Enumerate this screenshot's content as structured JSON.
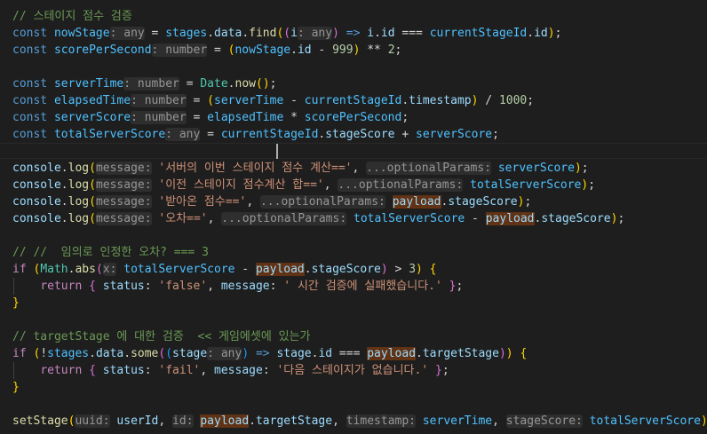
{
  "editor": {
    "language": "typescript",
    "theme": "dark",
    "cursor": {
      "line": 8,
      "column": 38
    },
    "highlighted_identifier": "payload",
    "lines": [
      [
        {
          "t": "// 스테이지 점수 검증",
          "c": "comment"
        }
      ],
      [
        {
          "t": "const ",
          "c": "keyword"
        },
        {
          "t": "nowStage",
          "c": "const"
        },
        {
          "t": ": any",
          "c": "hint"
        },
        {
          "t": " = ",
          "c": "text"
        },
        {
          "t": "stages",
          "c": "const"
        },
        {
          "t": ".",
          "c": "text"
        },
        {
          "t": "data",
          "c": "var"
        },
        {
          "t": ".",
          "c": "text"
        },
        {
          "t": "find",
          "c": "func"
        },
        {
          "t": "(",
          "c": "paren1"
        },
        {
          "t": "(",
          "c": "paren2"
        },
        {
          "t": "i",
          "c": "var"
        },
        {
          "t": ": any",
          "c": "hint"
        },
        {
          "t": ")",
          "c": "paren2"
        },
        {
          "t": " => ",
          "c": "keyword"
        },
        {
          "t": "i",
          "c": "var"
        },
        {
          "t": ".",
          "c": "text"
        },
        {
          "t": "id",
          "c": "var"
        },
        {
          "t": " === ",
          "c": "text"
        },
        {
          "t": "currentStageId",
          "c": "const"
        },
        {
          "t": ".",
          "c": "text"
        },
        {
          "t": "id",
          "c": "var"
        },
        {
          "t": ")",
          "c": "paren1"
        },
        {
          "t": ";",
          "c": "text"
        }
      ],
      [
        {
          "t": "const ",
          "c": "keyword"
        },
        {
          "t": "scorePerSecond",
          "c": "const"
        },
        {
          "t": ": number",
          "c": "hint"
        },
        {
          "t": " = ",
          "c": "text"
        },
        {
          "t": "(",
          "c": "paren1"
        },
        {
          "t": "nowStage",
          "c": "const"
        },
        {
          "t": ".",
          "c": "text"
        },
        {
          "t": "id",
          "c": "var"
        },
        {
          "t": " - ",
          "c": "text"
        },
        {
          "t": "999",
          "c": "number"
        },
        {
          "t": ")",
          "c": "paren1"
        },
        {
          "t": " ** ",
          "c": "text"
        },
        {
          "t": "2",
          "c": "number"
        },
        {
          "t": ";",
          "c": "text"
        }
      ],
      [],
      [
        {
          "t": "const ",
          "c": "keyword"
        },
        {
          "t": "serverTime",
          "c": "const"
        },
        {
          "t": ": number",
          "c": "hint"
        },
        {
          "t": " = ",
          "c": "text"
        },
        {
          "t": "Date",
          "c": "type"
        },
        {
          "t": ".",
          "c": "text"
        },
        {
          "t": "now",
          "c": "func"
        },
        {
          "t": "(",
          "c": "paren1"
        },
        {
          "t": ")",
          "c": "paren1"
        },
        {
          "t": ";",
          "c": "text"
        }
      ],
      [
        {
          "t": "const ",
          "c": "keyword"
        },
        {
          "t": "elapsedTime",
          "c": "const"
        },
        {
          "t": ": number",
          "c": "hint"
        },
        {
          "t": " = ",
          "c": "text"
        },
        {
          "t": "(",
          "c": "paren1"
        },
        {
          "t": "serverTime",
          "c": "const"
        },
        {
          "t": " - ",
          "c": "text"
        },
        {
          "t": "currentStageId",
          "c": "const"
        },
        {
          "t": ".",
          "c": "text"
        },
        {
          "t": "timestamp",
          "c": "var"
        },
        {
          "t": ")",
          "c": "paren1"
        },
        {
          "t": " / ",
          "c": "text"
        },
        {
          "t": "1000",
          "c": "number"
        },
        {
          "t": ";",
          "c": "text"
        }
      ],
      [
        {
          "t": "const ",
          "c": "keyword"
        },
        {
          "t": "serverScore",
          "c": "const"
        },
        {
          "t": ": number",
          "c": "hint"
        },
        {
          "t": " = ",
          "c": "text"
        },
        {
          "t": "elapsedTime",
          "c": "const"
        },
        {
          "t": " * ",
          "c": "text"
        },
        {
          "t": "scorePerSecond",
          "c": "const"
        },
        {
          "t": ";",
          "c": "text"
        }
      ],
      [
        {
          "t": "const ",
          "c": "keyword"
        },
        {
          "t": "totalServerScore",
          "c": "const"
        },
        {
          "t": ": any",
          "c": "hint"
        },
        {
          "t": " = ",
          "c": "text"
        },
        {
          "t": "currentStageId",
          "c": "const"
        },
        {
          "t": ".",
          "c": "text"
        },
        {
          "t": "stageScore",
          "c": "var"
        },
        {
          "t": " + ",
          "c": "text"
        },
        {
          "t": "serverScore",
          "c": "const"
        },
        {
          "t": ";",
          "c": "text"
        }
      ],
      [],
      [
        {
          "t": "console",
          "c": "var"
        },
        {
          "t": ".",
          "c": "text"
        },
        {
          "t": "log",
          "c": "func"
        },
        {
          "t": "(",
          "c": "paren1"
        },
        {
          "t": "message:",
          "c": "hint"
        },
        {
          "t": " ",
          "c": "text"
        },
        {
          "t": "'서버의 이번 스테이지 점수 계산=='",
          "c": "string"
        },
        {
          "t": ", ",
          "c": "text"
        },
        {
          "t": "...optionalParams:",
          "c": "hint"
        },
        {
          "t": " ",
          "c": "text"
        },
        {
          "t": "serverScore",
          "c": "const"
        },
        {
          "t": ")",
          "c": "paren1"
        },
        {
          "t": ";",
          "c": "text"
        }
      ],
      [
        {
          "t": "console",
          "c": "var"
        },
        {
          "t": ".",
          "c": "text"
        },
        {
          "t": "log",
          "c": "func"
        },
        {
          "t": "(",
          "c": "paren1"
        },
        {
          "t": "message:",
          "c": "hint"
        },
        {
          "t": " ",
          "c": "text"
        },
        {
          "t": "'이전 스테이지 점수계산 합=='",
          "c": "string"
        },
        {
          "t": ", ",
          "c": "text"
        },
        {
          "t": "...optionalParams:",
          "c": "hint"
        },
        {
          "t": " ",
          "c": "text"
        },
        {
          "t": "totalServerScore",
          "c": "const"
        },
        {
          "t": ")",
          "c": "paren1"
        },
        {
          "t": ";",
          "c": "text"
        }
      ],
      [
        {
          "t": "console",
          "c": "var"
        },
        {
          "t": ".",
          "c": "text"
        },
        {
          "t": "log",
          "c": "func"
        },
        {
          "t": "(",
          "c": "paren1"
        },
        {
          "t": "message:",
          "c": "hint"
        },
        {
          "t": " ",
          "c": "text"
        },
        {
          "t": "'받아온 점수=='",
          "c": "string"
        },
        {
          "t": ", ",
          "c": "text"
        },
        {
          "t": "...optionalParams:",
          "c": "hint"
        },
        {
          "t": " ",
          "c": "text"
        },
        {
          "t": "payload",
          "c": "var",
          "hl": true
        },
        {
          "t": ".",
          "c": "text"
        },
        {
          "t": "stageScore",
          "c": "var"
        },
        {
          "t": ")",
          "c": "paren1"
        },
        {
          "t": ";",
          "c": "text"
        }
      ],
      [
        {
          "t": "console",
          "c": "var"
        },
        {
          "t": ".",
          "c": "text"
        },
        {
          "t": "log",
          "c": "func"
        },
        {
          "t": "(",
          "c": "paren1"
        },
        {
          "t": "message:",
          "c": "hint"
        },
        {
          "t": " ",
          "c": "text"
        },
        {
          "t": "'오차=='",
          "c": "string"
        },
        {
          "t": ", ",
          "c": "text"
        },
        {
          "t": "...optionalParams:",
          "c": "hint"
        },
        {
          "t": " ",
          "c": "text"
        },
        {
          "t": "totalServerScore",
          "c": "const"
        },
        {
          "t": " - ",
          "c": "text"
        },
        {
          "t": "payload",
          "c": "var",
          "hl": true
        },
        {
          "t": ".",
          "c": "text"
        },
        {
          "t": "stageScore",
          "c": "var"
        },
        {
          "t": ")",
          "c": "paren1"
        },
        {
          "t": ";",
          "c": "text"
        }
      ],
      [],
      [
        {
          "t": "// //  임의로 인정한 오차? === 3",
          "c": "comment"
        }
      ],
      [
        {
          "t": "if ",
          "c": "control"
        },
        {
          "t": "(",
          "c": "paren1"
        },
        {
          "t": "Math",
          "c": "type"
        },
        {
          "t": ".",
          "c": "text"
        },
        {
          "t": "abs",
          "c": "func"
        },
        {
          "t": "(",
          "c": "paren2"
        },
        {
          "t": "x:",
          "c": "hint"
        },
        {
          "t": " ",
          "c": "text"
        },
        {
          "t": "totalServerScore",
          "c": "const"
        },
        {
          "t": " - ",
          "c": "text"
        },
        {
          "t": "payload",
          "c": "var",
          "hl": true
        },
        {
          "t": ".",
          "c": "text"
        },
        {
          "t": "stageScore",
          "c": "var"
        },
        {
          "t": ")",
          "c": "paren2"
        },
        {
          "t": " > ",
          "c": "text"
        },
        {
          "t": "3",
          "c": "number"
        },
        {
          "t": ")",
          "c": "paren1"
        },
        {
          "t": " ",
          "c": "text"
        },
        {
          "t": "{",
          "c": "paren1"
        }
      ],
      [
        {
          "t": "    ",
          "c": "text"
        },
        {
          "t": "return ",
          "c": "control"
        },
        {
          "t": "{",
          "c": "paren2"
        },
        {
          "t": " ",
          "c": "text"
        },
        {
          "t": "status",
          "c": "var"
        },
        {
          "t": ": ",
          "c": "text"
        },
        {
          "t": "'false'",
          "c": "string"
        },
        {
          "t": ", ",
          "c": "text"
        },
        {
          "t": "message",
          "c": "var"
        },
        {
          "t": ": ",
          "c": "text"
        },
        {
          "t": "' 시간 검증에 실패했습니다.'",
          "c": "string"
        },
        {
          "t": " ",
          "c": "text"
        },
        {
          "t": "}",
          "c": "paren2"
        },
        {
          "t": ";",
          "c": "text"
        }
      ],
      [
        {
          "t": "}",
          "c": "paren1"
        }
      ],
      [],
      [
        {
          "t": "// targetStage 에 대한 검증  << 게임에셋에 있는가",
          "c": "comment"
        }
      ],
      [
        {
          "t": "if ",
          "c": "control"
        },
        {
          "t": "(",
          "c": "paren1"
        },
        {
          "t": "!",
          "c": "text"
        },
        {
          "t": "stages",
          "c": "const"
        },
        {
          "t": ".",
          "c": "text"
        },
        {
          "t": "data",
          "c": "var"
        },
        {
          "t": ".",
          "c": "text"
        },
        {
          "t": "some",
          "c": "func"
        },
        {
          "t": "(",
          "c": "paren2"
        },
        {
          "t": "(",
          "c": "paren3"
        },
        {
          "t": "stage",
          "c": "var"
        },
        {
          "t": ": any",
          "c": "hint"
        },
        {
          "t": ")",
          "c": "paren3"
        },
        {
          "t": " => ",
          "c": "keyword"
        },
        {
          "t": "stage",
          "c": "var"
        },
        {
          "t": ".",
          "c": "text"
        },
        {
          "t": "id",
          "c": "var"
        },
        {
          "t": " === ",
          "c": "text"
        },
        {
          "t": "payload",
          "c": "var",
          "hl": true
        },
        {
          "t": ".",
          "c": "text"
        },
        {
          "t": "targetStage",
          "c": "var"
        },
        {
          "t": ")",
          "c": "paren2"
        },
        {
          "t": ")",
          "c": "paren1"
        },
        {
          "t": " ",
          "c": "text"
        },
        {
          "t": "{",
          "c": "paren1"
        }
      ],
      [
        {
          "t": "    ",
          "c": "text"
        },
        {
          "t": "return ",
          "c": "control"
        },
        {
          "t": "{",
          "c": "paren2"
        },
        {
          "t": " ",
          "c": "text"
        },
        {
          "t": "status",
          "c": "var"
        },
        {
          "t": ": ",
          "c": "text"
        },
        {
          "t": "'fail'",
          "c": "string"
        },
        {
          "t": ", ",
          "c": "text"
        },
        {
          "t": "message",
          "c": "var"
        },
        {
          "t": ": ",
          "c": "text"
        },
        {
          "t": "'다음 스테이지가 없습니다.'",
          "c": "string"
        },
        {
          "t": " ",
          "c": "text"
        },
        {
          "t": "}",
          "c": "paren2"
        },
        {
          "t": ";",
          "c": "text"
        }
      ],
      [
        {
          "t": "}",
          "c": "paren1"
        }
      ],
      [],
      [
        {
          "t": "setStage",
          "c": "func"
        },
        {
          "t": "(",
          "c": "paren1"
        },
        {
          "t": "uuid:",
          "c": "hint"
        },
        {
          "t": " ",
          "c": "text"
        },
        {
          "t": "userId",
          "c": "var"
        },
        {
          "t": ", ",
          "c": "text"
        },
        {
          "t": "id:",
          "c": "hint"
        },
        {
          "t": " ",
          "c": "text"
        },
        {
          "t": "payload",
          "c": "var",
          "hl": true
        },
        {
          "t": ".",
          "c": "text"
        },
        {
          "t": "targetStage",
          "c": "var"
        },
        {
          "t": ", ",
          "c": "text"
        },
        {
          "t": "timestamp:",
          "c": "hint"
        },
        {
          "t": " ",
          "c": "text"
        },
        {
          "t": "serverTime",
          "c": "const"
        },
        {
          "t": ", ",
          "c": "text"
        },
        {
          "t": "stageScore:",
          "c": "hint"
        },
        {
          "t": " ",
          "c": "text"
        },
        {
          "t": "totalServerScore",
          "c": "const"
        },
        {
          "t": ")",
          "c": "paren1"
        },
        {
          "t": ";",
          "c": "text"
        }
      ]
    ]
  }
}
